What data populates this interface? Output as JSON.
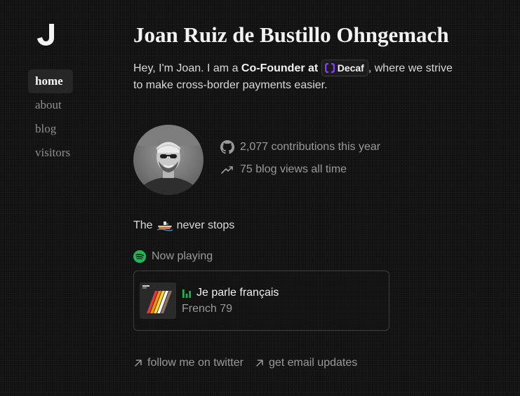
{
  "nav": {
    "items": [
      {
        "label": "home",
        "active": true
      },
      {
        "label": "about",
        "active": false
      },
      {
        "label": "blog",
        "active": false
      },
      {
        "label": "visitors",
        "active": false
      }
    ]
  },
  "logo": {
    "glyph": "J"
  },
  "main": {
    "title": "Joan Ruiz de Bustillo Ohngemach",
    "intro": {
      "before": "Hey, I'm Joan. I am a ",
      "role": "Co-Founder at",
      "company": "Decaf",
      "after": ", where we strive to make cross-border payments easier."
    },
    "stats": {
      "contributions": "2,077 contributions this year",
      "blog_views": "75 blog views all time"
    },
    "tagline": {
      "before": "The",
      "emoji": "🚤",
      "after": "never stops"
    },
    "now_playing": {
      "label": "Now playing",
      "track": "Je parle français",
      "artist": "French 79"
    },
    "links": [
      {
        "label": "follow me on twitter"
      },
      {
        "label": "get email updates"
      }
    ]
  },
  "colors": {
    "background": "#111111",
    "spotify_green": "#1DB954",
    "decaf_purple": "#8b3dff"
  },
  "icons": [
    "github-icon",
    "trending-up-icon",
    "spotify-icon",
    "equalizer-icon",
    "arrow-up-right-icon"
  ]
}
